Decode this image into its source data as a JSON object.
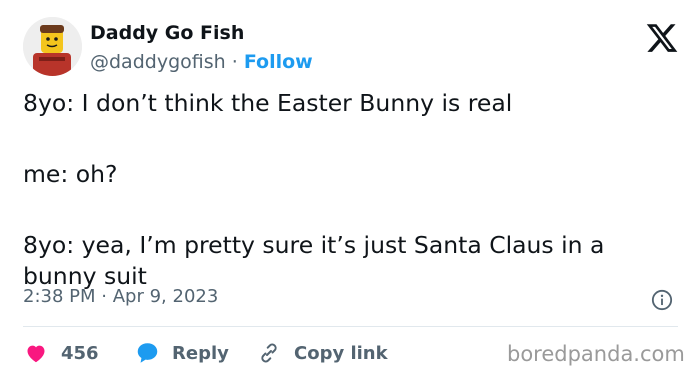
{
  "author": {
    "name": "Daddy Go Fish",
    "handle": "@daddygofish",
    "separator": "·",
    "follow_label": "Follow"
  },
  "tweet": {
    "lines": [
      "8yo: I don’t think the Easter Bunny is real",
      "me: oh?",
      "8yo: yea, I’m pretty sure it’s just Santa Claus in a bunny suit"
    ],
    "time": "2:38 PM",
    "meta_separator": "·",
    "date": "Apr 9, 2023"
  },
  "actions": {
    "like_count": "456",
    "reply_label": "Reply",
    "copy_link_label": "Copy link"
  },
  "icons": {
    "x_logo": "x-logo-icon",
    "info": "info-icon",
    "like": "heart-icon",
    "reply": "reply-bubble-icon",
    "link": "link-icon"
  },
  "colors": {
    "like": "#f91880",
    "reply": "#1d9bf0",
    "follow": "#1d9bf0",
    "secondary_text": "#536471"
  },
  "watermark": "boredpanda.com"
}
